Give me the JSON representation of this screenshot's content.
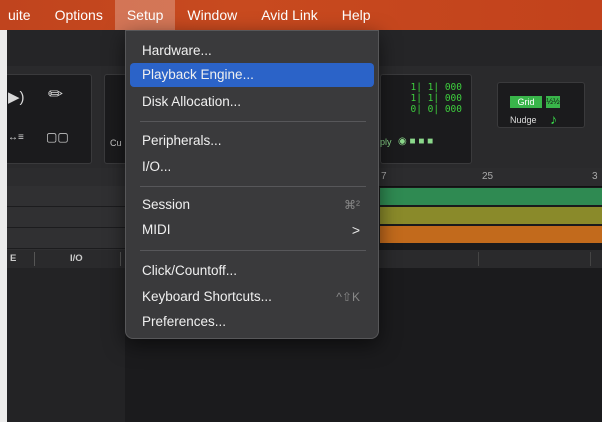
{
  "menubar": {
    "items": [
      "uite",
      "Options",
      "Setup",
      "Window",
      "Avid Link",
      "Help"
    ],
    "active_index": 2
  },
  "toolbar": {
    "counters": [
      "1| 1| 000",
      "1| 1| 000",
      "0| 0| 000"
    ],
    "cu_label": "Cu",
    "ply_label": "ply",
    "grid_label": "Grid",
    "grid_chip": "½½",
    "nudge_label": "Nudge"
  },
  "ruler": {
    "labels": [
      "7",
      "25",
      "3"
    ]
  },
  "bottom_header": {
    "labels": [
      "E",
      "I/O"
    ]
  },
  "setup_menu": {
    "items": [
      {
        "label": "Hardware...",
        "shortcut": "",
        "submenu": false,
        "highlighted": false
      },
      {
        "label": "Playback Engine...",
        "shortcut": "",
        "submenu": false,
        "highlighted": true
      },
      {
        "label": "Disk Allocation...",
        "shortcut": "",
        "submenu": false,
        "highlighted": false
      },
      {
        "label": "Peripherals...",
        "shortcut": "",
        "submenu": false,
        "highlighted": false
      },
      {
        "label": "I/O...",
        "shortcut": "",
        "submenu": false,
        "highlighted": false
      },
      {
        "label": "Session",
        "shortcut": "⌘²",
        "submenu": false,
        "highlighted": false
      },
      {
        "label": "MIDI",
        "shortcut": "",
        "submenu": true,
        "highlighted": false
      },
      {
        "label": "Click/Countoff...",
        "shortcut": "",
        "submenu": false,
        "highlighted": false
      },
      {
        "label": "Keyboard Shortcuts...",
        "shortcut": "^⇧K",
        "submenu": false,
        "highlighted": false
      },
      {
        "label": "Preferences...",
        "shortcut": "",
        "submenu": false,
        "highlighted": false
      }
    ],
    "submenu_arrow": ">"
  },
  "colors": {
    "menubar": "#c84a1f",
    "highlight": "#2b63c8",
    "track_green": "#2f8a52",
    "track_olive": "#8a8a2a",
    "track_orange": "#c26a1c",
    "counter_green": "#3ecf3e"
  }
}
